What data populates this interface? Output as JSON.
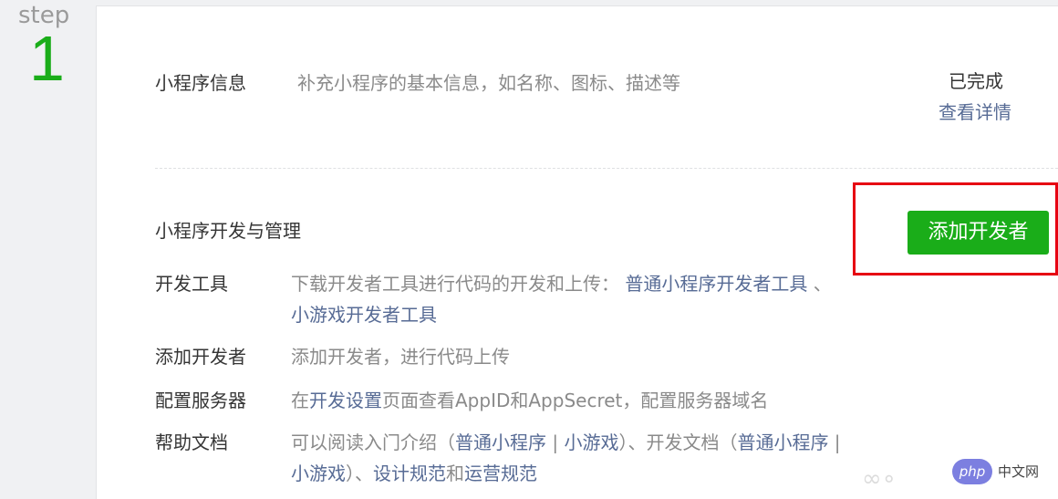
{
  "step": {
    "word": "step",
    "number": "1"
  },
  "info": {
    "title": "小程序信息",
    "desc": "补充小程序的基本信息，如名称、图标、描述等",
    "status": "已完成",
    "detail_link": "查看详情"
  },
  "dev": {
    "title": "小程序开发与管理",
    "add_button": "添加开发者",
    "rows": [
      {
        "label": "开发工具",
        "text1": "下载开发者工具进行代码的开发和上传：",
        "link1": "普通小程序开发者工具",
        "sep1": "、",
        "link2": "小游戏开发者工具"
      },
      {
        "label": "添加开发者",
        "text1": "添加开发者，进行代码上传"
      },
      {
        "label": "配置服务器",
        "text1": "在",
        "link1": "开发设置",
        "text2": "页面查看AppID和AppSecret，配置服务器域名"
      },
      {
        "label": "帮助文档",
        "text1": "可以阅读入门介绍（",
        "link1": "普通小程序",
        "sep1": " | ",
        "link2": "小游戏",
        "text2": "）、开发文档（",
        "link3": "普通小程序",
        "sep2": " |",
        "link4": "小游戏",
        "text3": "）、",
        "link5": "设计规范",
        "text4": "和",
        "link6": "运营规范"
      }
    ]
  },
  "watermark": {
    "badge": "php",
    "text": "中文网"
  }
}
